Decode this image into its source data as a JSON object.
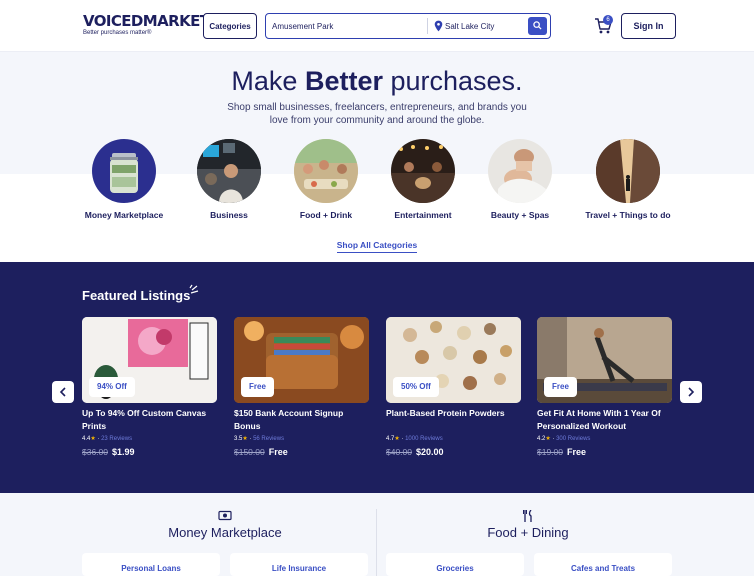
{
  "header": {
    "logo_title": "VOICEDMARKET",
    "logo_reg": "®",
    "logo_tagline": "Better purchases matter®",
    "categories_label": "Categories",
    "search_value": "Amusement Park",
    "location_value": "Salt Lake City",
    "cart_count": "6",
    "signin_label": "Sign In"
  },
  "hero": {
    "title_pre": "Make ",
    "title_bold": "Better",
    "title_post": " purchases.",
    "subtitle": "Shop small businesses, freelancers, entrepreneurs, and brands you love from your community and around the globe."
  },
  "categories": [
    {
      "label": "Money Marketplace"
    },
    {
      "label": "Business"
    },
    {
      "label": "Food + Drink"
    },
    {
      "label": "Entertainment"
    },
    {
      "label": "Beauty + Spas"
    },
    {
      "label": "Travel + Things to do"
    }
  ],
  "shop_all_label": "Shop All Categories",
  "featured": {
    "title": "Featured Listings",
    "cards": [
      {
        "badge": "94% Off",
        "title": "Up To 94% Off Custom Canvas Prints",
        "rating": "4.4",
        "reviews": "23 Reviews",
        "old_price": "$36.00",
        "new_price": "$1.99"
      },
      {
        "badge": "Free",
        "title": "$150 Bank Account Signup Bonus",
        "rating": "3.5",
        "reviews": "56 Reviews",
        "old_price": "$150.00",
        "new_price": "Free"
      },
      {
        "badge": "50% Off",
        "title": "Plant-Based Protein Powders",
        "rating": "4.7",
        "reviews": "1000 Reviews",
        "old_price": "$40.00",
        "new_price": "$20.00"
      },
      {
        "badge": "Free",
        "title": "Get Fit At Home With 1 Year Of Personalized Workout",
        "rating": "4.2",
        "reviews": "300 Reviews",
        "old_price": "$19.00",
        "new_price": "Free"
      }
    ]
  },
  "sections": [
    {
      "title": "Money Marketplace",
      "items": [
        "Personal Loans",
        "Life Insurance"
      ]
    },
    {
      "title": "Food + Dining",
      "items": [
        "Groceries",
        "Cafes and Treats"
      ]
    }
  ],
  "colors": {
    "navy": "#1d1f5e",
    "accent": "#3a4fc4",
    "hero_bg": "#f4f6fb",
    "star": "#f4b400"
  }
}
